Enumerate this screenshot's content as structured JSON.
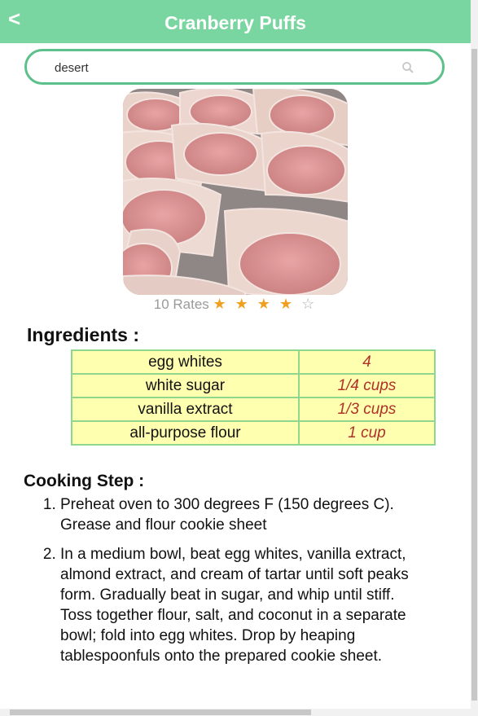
{
  "header": {
    "back_label": "<",
    "title": "Cranberry Puffs",
    "background_color": "#7ad6a1"
  },
  "search": {
    "value": "desert",
    "icon": "search-icon"
  },
  "recipe": {
    "image": "recipe-photo",
    "rates_label": "10 Rates",
    "rating": 4,
    "rating_max": 5,
    "stars_filled": "★ ★ ★ ★",
    "stars_empty": "☆"
  },
  "ingredients": {
    "heading": "Ingredients :",
    "items": [
      {
        "name": "egg whites",
        "qty": "4"
      },
      {
        "name": "white sugar",
        "qty": "1/4 cups"
      },
      {
        "name": "vanilla extract",
        "qty": "1/3 cups"
      },
      {
        "name": "all-purpose flour",
        "qty": "1 cup"
      }
    ]
  },
  "cooking": {
    "heading": "Cooking Step :",
    "steps": [
      "Preheat oven to 300 degrees F (150 degrees C). Grease and flour cookie sheet",
      "In a medium bowl, beat egg whites, vanilla extract, almond extract, and cream of tartar until soft peaks form. Gradually beat in sugar, and whip until stiff. Toss together flour, salt, and coconut in a separate bowl; fold into egg whites. Drop by heaping tablespoonfuls onto the prepared cookie sheet."
    ]
  }
}
